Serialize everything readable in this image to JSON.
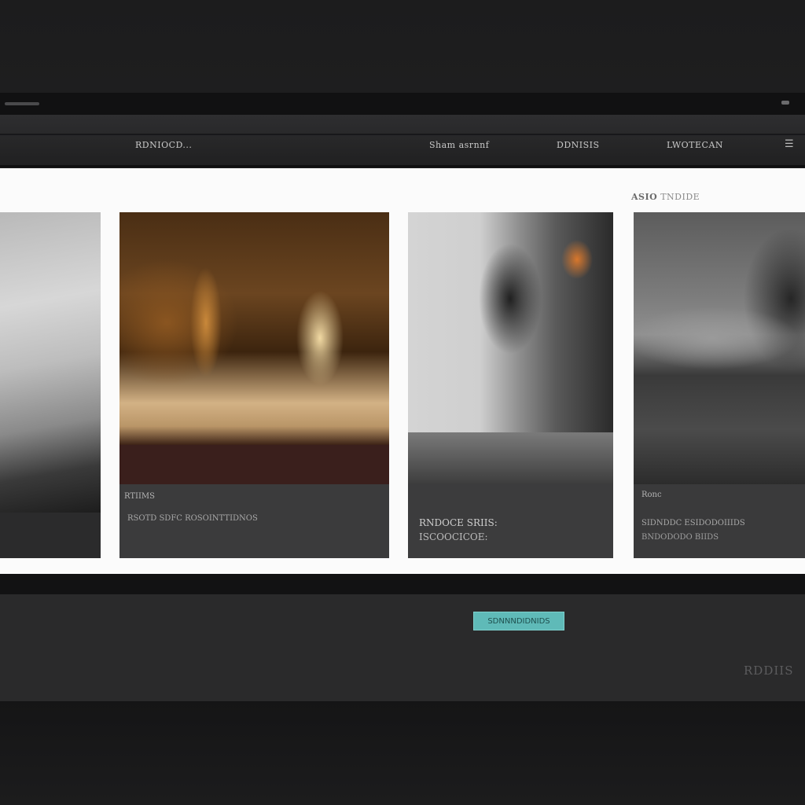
{
  "navbar": {
    "brand": "RDNIOCD...",
    "links": [
      "Sham asrnnf",
      "DDNISIS",
      "LWOTECAN"
    ],
    "menu_icon": "hamburger-icon"
  },
  "panel": {
    "label_bold": "ASIO",
    "label": "TNDIDE"
  },
  "cards": [
    {
      "title": "",
      "desc": "",
      "desc2": ""
    },
    {
      "title": "RTIIMS",
      "desc": "RSOTD SDFC ROSOINTTIDNOS",
      "desc2": ""
    },
    {
      "title": "",
      "desc": "RNDOCE SRIIS:",
      "desc2": "ISCOOCICOE:"
    },
    {
      "title": "Ronc",
      "desc": "SIDNDDC ESIDODOIIIDS",
      "desc2": "BNDODODO BIIDS"
    }
  ],
  "footer": {
    "cta_label": "SDNNNDIDNIDS",
    "mark": "RDDIIS"
  },
  "colors": {
    "accent": "#5fbab8",
    "background": "#1b1b1c",
    "panel": "#fbfbfb"
  }
}
